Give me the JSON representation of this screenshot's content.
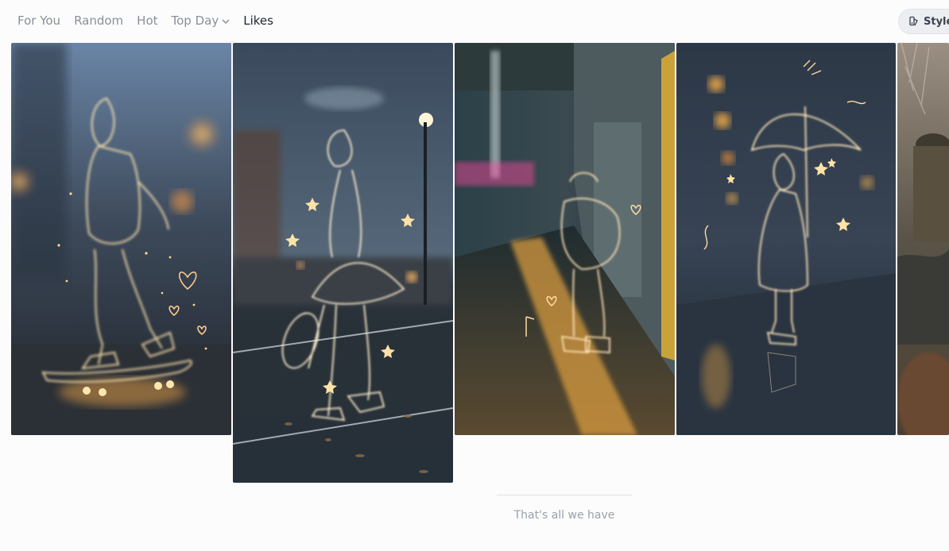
{
  "nav": {
    "items": [
      {
        "label": "For You"
      },
      {
        "label": "Random"
      },
      {
        "label": "Hot"
      },
      {
        "label": "Top Day"
      },
      {
        "label": "Likes"
      }
    ]
  },
  "style_button": {
    "label": "Style",
    "icon": "palette-icon"
  },
  "footer": {
    "end_message": "That's all we have"
  },
  "colors": {
    "active_nav": "#1f2430",
    "inactive_nav": "#8a8f98",
    "glow": "#ffd28a"
  }
}
